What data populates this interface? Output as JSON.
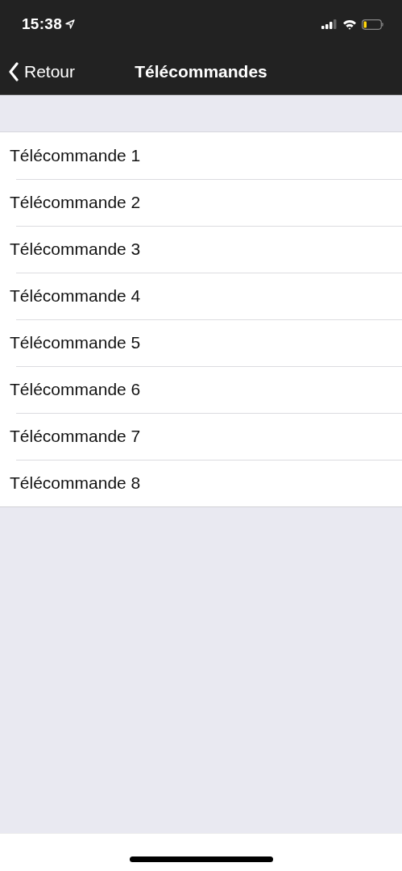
{
  "status_bar": {
    "time": "15:38"
  },
  "nav_bar": {
    "back": "Retour",
    "title": "Télécommandes"
  },
  "items": [
    {
      "label": "Télécommande 1"
    },
    {
      "label": "Télécommande 2"
    },
    {
      "label": "Télécommande 3"
    },
    {
      "label": "Télécommande 4"
    },
    {
      "label": "Télécommande 5"
    },
    {
      "label": "Télécommande 6"
    },
    {
      "label": "Télécommande 7"
    },
    {
      "label": "Télécommande 8"
    }
  ]
}
